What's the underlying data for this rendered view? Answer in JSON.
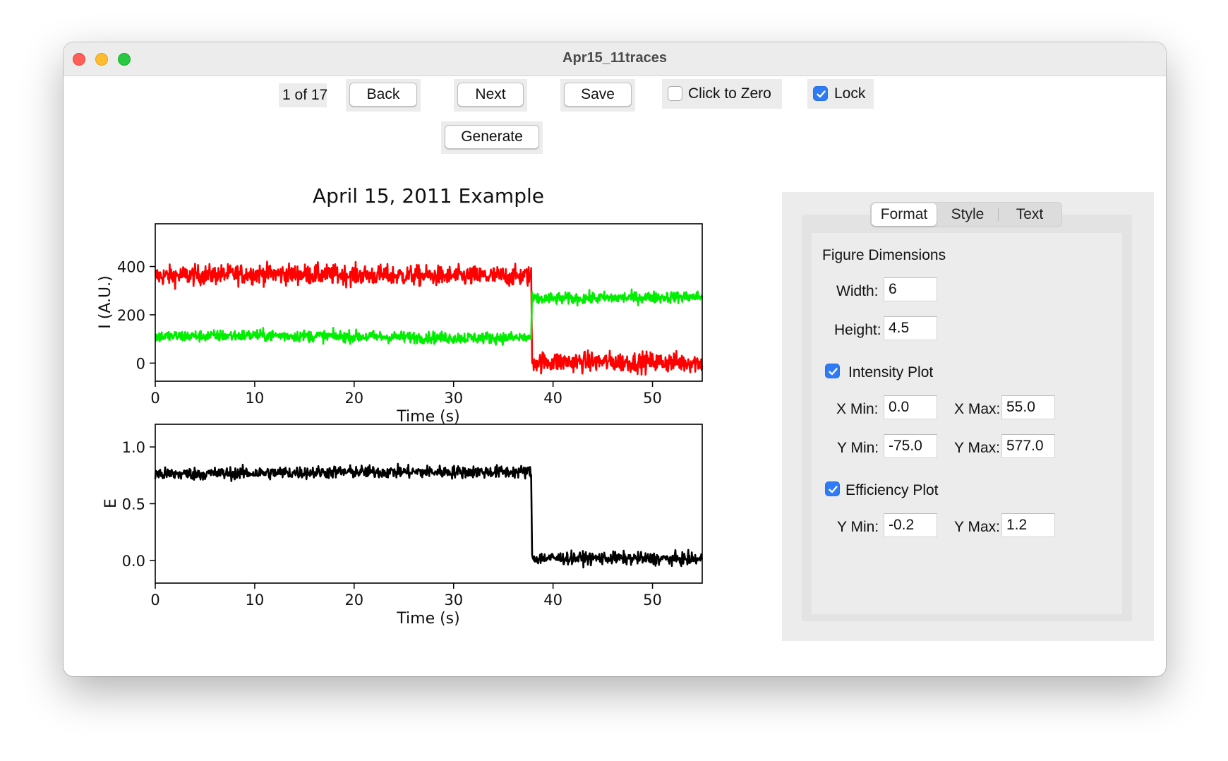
{
  "window": {
    "title": "Apr15_11traces"
  },
  "toolbar": {
    "page_indicator": "1 of 17",
    "back_label": "Back",
    "next_label": "Next",
    "save_label": "Save",
    "click_to_zero_label": "Click to Zero",
    "click_to_zero_checked": false,
    "lock_label": "Lock",
    "lock_checked": true,
    "generate_label": "Generate"
  },
  "tabs": {
    "format": "Format",
    "style": "Style",
    "text": "Text",
    "active": "Format"
  },
  "format": {
    "section_title": "Figure Dimensions",
    "width_label": "Width:",
    "width_value": "6",
    "height_label": "Height:",
    "height_value": "4.5",
    "intensity_label": "Intensity Plot",
    "intensity_checked": true,
    "xmin_label": "X Min:",
    "xmin_value": "0.0",
    "xmax_label": "X Max:",
    "xmax_value": "55.0",
    "ymin_label": "Y Min:",
    "ymin_value": "-75.0",
    "ymax_label": "Y Max:",
    "ymax_value": "577.0",
    "efficiency_label": "Efficiency Plot",
    "efficiency_checked": true,
    "eff_ymin_label": "Y Min:",
    "eff_ymin_value": "-0.2",
    "eff_ymax_label": "Y Max:",
    "eff_ymax_value": "1.2"
  },
  "colors": {
    "accent": "#2f7bf5",
    "red_trace": "#ff0000",
    "green_trace": "#00ee00",
    "efficiency_trace": "#000000"
  },
  "chart_data": [
    {
      "type": "line",
      "title": "April 15, 2011 Example",
      "xlabel": "Time (s)",
      "ylabel": "I (A.U.)",
      "xlim": [
        0,
        55
      ],
      "ylim": [
        -75,
        577
      ],
      "xticks": [
        0,
        10,
        20,
        30,
        40,
        50
      ],
      "yticks": [
        0,
        200,
        400
      ],
      "legend": "none",
      "grid": false,
      "series": [
        {
          "color": "#ff0000",
          "points": [
            [
              0,
              360
            ],
            [
              10,
              370
            ],
            [
              20,
              365
            ],
            [
              30,
              360
            ],
            [
              37.8,
              360
            ],
            [
              37.9,
              5
            ],
            [
              45,
              5
            ],
            [
              55,
              3
            ]
          ],
          "noise": 38
        },
        {
          "color": "#00ee00",
          "points": [
            [
              0,
              110
            ],
            [
              10,
              115
            ],
            [
              20,
              110
            ],
            [
              30,
              105
            ],
            [
              37.8,
              105
            ],
            [
              37.9,
              265
            ],
            [
              45,
              270
            ],
            [
              55,
              275
            ]
          ],
          "noise": 22
        }
      ]
    },
    {
      "type": "line",
      "title": "",
      "xlabel": "Time (s)",
      "ylabel": "E",
      "xlim": [
        0,
        55
      ],
      "ylim": [
        -0.2,
        1.2
      ],
      "xticks": [
        0,
        10,
        20,
        30,
        40,
        50
      ],
      "yticks": [
        0.0,
        0.5,
        1.0
      ],
      "ytick_labels": [
        "0.0",
        "0.5",
        "1.0"
      ],
      "legend": "none",
      "grid": false,
      "series": [
        {
          "color": "#000000",
          "points": [
            [
              0,
              0.76
            ],
            [
              10,
              0.77
            ],
            [
              20,
              0.78
            ],
            [
              30,
              0.78
            ],
            [
              37.8,
              0.78
            ],
            [
              37.9,
              0.02
            ],
            [
              45,
              0.02
            ],
            [
              55,
              0.01
            ]
          ],
          "noise": 0.05
        }
      ]
    }
  ]
}
